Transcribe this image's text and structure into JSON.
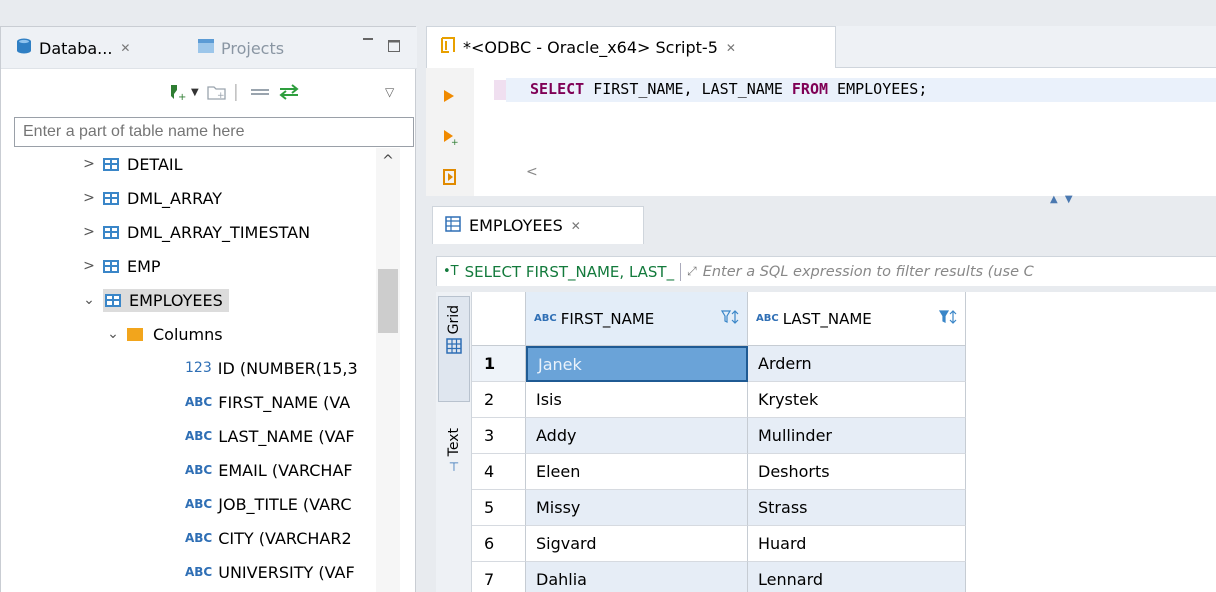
{
  "navigator": {
    "tabs": [
      {
        "label": "Databa...",
        "close": "✕"
      },
      {
        "label": "Projects"
      }
    ],
    "search_placeholder": "Enter a part of table name here",
    "tree": [
      {
        "arrow": ">",
        "label": "DETAIL"
      },
      {
        "arrow": ">",
        "label": "DML_ARRAY"
      },
      {
        "arrow": ">",
        "label": "DML_ARRAY_TIMESTAN"
      },
      {
        "arrow": ">",
        "label": "EMP"
      },
      {
        "arrow": "v",
        "label": "EMPLOYEES"
      },
      {
        "arrow": "v",
        "label": "Columns"
      },
      {
        "type": "123",
        "label": "ID (NUMBER(15,3"
      },
      {
        "type": "ABC",
        "label": "FIRST_NAME (VA"
      },
      {
        "type": "ABC",
        "label": "LAST_NAME (VAF"
      },
      {
        "type": "ABC",
        "label": "EMAIL (VARCHAF"
      },
      {
        "type": "ABC",
        "label": "JOB_TITLE (VARC"
      },
      {
        "type": "ABC",
        "label": "CITY (VARCHAR2"
      },
      {
        "type": "ABC",
        "label": "UNIVERSITY (VAF"
      }
    ]
  },
  "editor": {
    "tab_label": "*<ODBC - Oracle_x64> Script-5",
    "tab_close": "✕",
    "sql": {
      "kw1": "SELECT",
      "cols": " FIRST_NAME, LAST_NAME ",
      "kw2": "FROM",
      "rest": " EMPLOYEES;"
    },
    "hscroll_left": "<"
  },
  "results": {
    "tab_label": "EMPLOYEES",
    "tab_close": "✕",
    "filter_query": "SELECT FIRST_NAME, LAST_",
    "filter_placeholder": "Enter a SQL expression to filter results (use C",
    "side_tabs": [
      "Grid",
      "Text"
    ],
    "columns": [
      "FIRST_NAME",
      "LAST_NAME"
    ],
    "col_type": "ABC",
    "rows": [
      {
        "n": "1",
        "first": "Janek",
        "last": "Ardern"
      },
      {
        "n": "2",
        "first": "Isis",
        "last": "Krystek"
      },
      {
        "n": "3",
        "first": "Addy",
        "last": "Mullinder"
      },
      {
        "n": "4",
        "first": "Eleen",
        "last": "Deshorts"
      },
      {
        "n": "5",
        "first": "Missy",
        "last": "Strass"
      },
      {
        "n": "6",
        "first": "Sigvard",
        "last": "Huard"
      },
      {
        "n": "7",
        "first": "Dahlia",
        "last": "Lennard"
      }
    ]
  }
}
